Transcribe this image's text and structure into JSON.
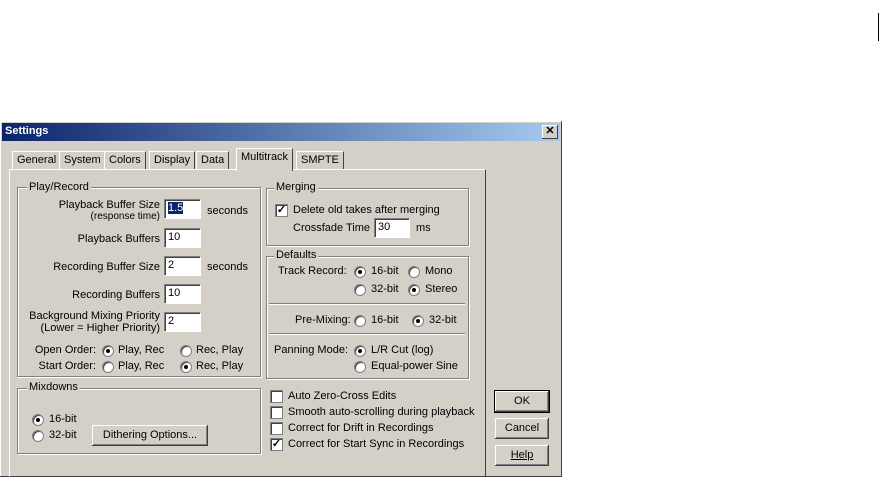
{
  "dialog": {
    "title": "Settings",
    "close_glyph": "✕"
  },
  "tabs": [
    {
      "label": "General"
    },
    {
      "label": "System"
    },
    {
      "label": "Colors"
    },
    {
      "label": "Display"
    },
    {
      "label": "Data"
    },
    {
      "label": "Multitrack",
      "active": true
    },
    {
      "label": "SMPTE"
    }
  ],
  "play_record": {
    "title": "Play/Record",
    "playback_buffer_size_label": "Playback Buffer Size",
    "playback_buffer_size_sub": "(response time)",
    "playback_buffer_size_value": "1.5",
    "playback_buffer_size_unit": "seconds",
    "playback_buffers_label": "Playback Buffers",
    "playback_buffers_value": "10",
    "recording_buffer_size_label": "Recording Buffer Size",
    "recording_buffer_size_value": "2",
    "recording_buffer_size_unit": "seconds",
    "recording_buffers_label": "Recording Buffers",
    "recording_buffers_value": "10",
    "bg_priority_label": "Background Mixing Priority",
    "bg_priority_sub": "(Lower = Higher Priority)",
    "bg_priority_value": "2",
    "open_order_label": "Open Order:",
    "start_order_label": "Start Order:",
    "opt_play_rec": "Play, Rec",
    "opt_rec_play": "Rec, Play"
  },
  "mixdowns": {
    "title": "Mixdowns",
    "opt_16bit": "16-bit",
    "opt_32bit": "32-bit",
    "dithering_button": "Dithering Options..."
  },
  "merging": {
    "title": "Merging",
    "delete_old_takes": "Delete old takes after merging",
    "crossfade_label": "Crossfade Time",
    "crossfade_value": "30",
    "crossfade_unit": "ms"
  },
  "defaults": {
    "title": "Defaults",
    "track_record_label": "Track Record:",
    "opt_16bit": "16-bit",
    "opt_32bit": "32-bit",
    "opt_mono": "Mono",
    "opt_stereo": "Stereo",
    "premixing_label": "Pre-Mixing:",
    "panning_label": "Panning Mode:",
    "opt_lr_cut": "L/R Cut (log)",
    "opt_equal_power": "Equal-power Sine"
  },
  "options": {
    "auto_zero_cross": "Auto Zero-Cross Edits",
    "smooth_scroll": "Smooth auto-scrolling during playback",
    "correct_drift": "Correct for Drift in Recordings",
    "correct_start_sync": "Correct for Start Sync in Recordings"
  },
  "buttons": {
    "ok": "OK",
    "cancel": "Cancel",
    "help": "Help"
  },
  "colors": {
    "title_bar_start": "#0a246a",
    "title_bar_end": "#a6caf0",
    "face": "#d4d0c8"
  }
}
